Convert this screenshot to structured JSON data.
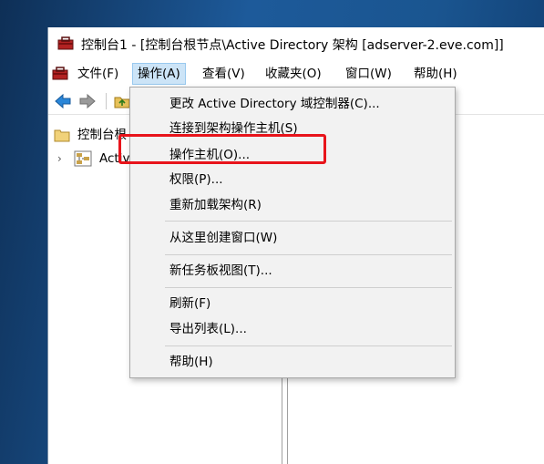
{
  "window": {
    "title": "控制台1 - [控制台根节点\\Active Directory 架构 [adserver-2.eve.com]]"
  },
  "menubar": {
    "items": [
      {
        "label": "文件(F)"
      },
      {
        "label": "操作(A)"
      },
      {
        "label": "查看(V)"
      },
      {
        "label": "收藏夹(O)"
      },
      {
        "label": "窗口(W)"
      },
      {
        "label": "帮助(H)"
      }
    ]
  },
  "tree": {
    "root_label": "控制台根",
    "child_label": "Activ"
  },
  "context_menu": {
    "items": [
      {
        "label": "更改 Active Directory 域控制器(C)..."
      },
      {
        "label": "连接到架构操作主机(S)"
      },
      {
        "label": "操作主机(O)..."
      },
      {
        "label": "权限(P)..."
      },
      {
        "label": "重新加载架构(R)"
      },
      {
        "label": "从这里创建窗口(W)"
      },
      {
        "label": "新任务板视图(T)..."
      },
      {
        "label": "刷新(F)"
      },
      {
        "label": "导出列表(L)..."
      },
      {
        "label": "帮助(H)"
      }
    ]
  },
  "colors": {
    "highlight_border": "#e8141b",
    "menu_active_bg": "#cce4f7",
    "desktop": "#1c4f86"
  }
}
